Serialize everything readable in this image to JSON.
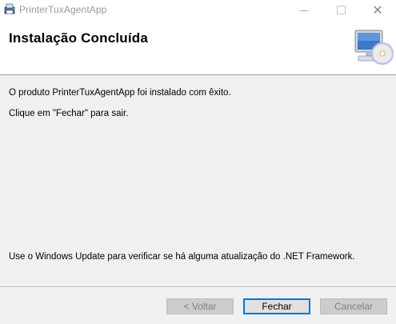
{
  "window": {
    "title": "PrinterTuxAgentApp",
    "minimize_icon": "minimize-icon",
    "maximize_icon": "maximize-icon",
    "close_symbol": "✕"
  },
  "banner": {
    "title": "Instalação Concluída",
    "icon": "computer-cd-icon"
  },
  "body": {
    "message_installed": "O produto PrinterTuxAgentApp foi instalado com êxito.",
    "message_close": "Clique em \"Fechar\" para sair.",
    "message_update": "Use o Windows Update para verificar se há alguma atualização do .NET Framework."
  },
  "buttons": {
    "back_label": "< Voltar",
    "close_label": "Fechar",
    "cancel_label": "Cancelar"
  },
  "colors": {
    "focus_border": "#0078d7",
    "disabled_text": "#7f7f7f"
  }
}
